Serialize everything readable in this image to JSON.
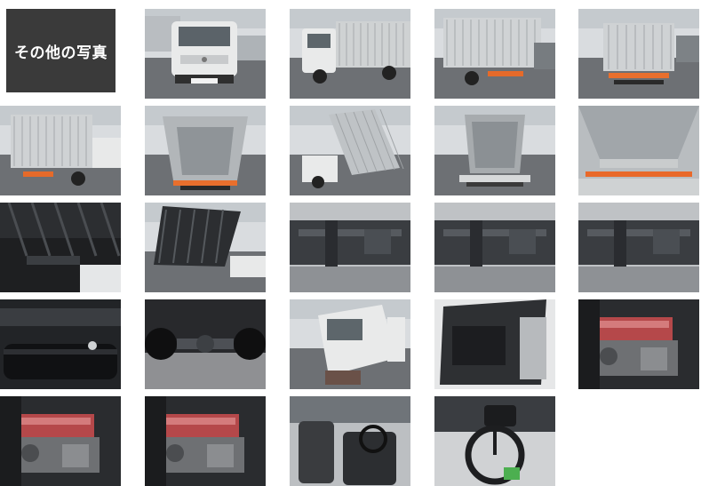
{
  "gallery": {
    "heading": "その他の写真",
    "thumbnails": [
      {
        "name": "photo-truck-front",
        "kind": "front"
      },
      {
        "name": "photo-truck-front-side",
        "kind": "frontside"
      },
      {
        "name": "photo-truck-rear-side",
        "kind": "rearside"
      },
      {
        "name": "photo-truck-rear",
        "kind": "rear"
      },
      {
        "name": "photo-truck-rear-left",
        "kind": "rearleft"
      },
      {
        "name": "photo-dump-bed-interior",
        "kind": "bedinterior"
      },
      {
        "name": "photo-dump-bed-raised-side",
        "kind": "raisedside"
      },
      {
        "name": "photo-dump-bed-raised-rear",
        "kind": "raisedrear"
      },
      {
        "name": "photo-bed-floor",
        "kind": "bedfloor"
      },
      {
        "name": "photo-hoist-underside",
        "kind": "underside"
      },
      {
        "name": "photo-hoist-raised",
        "kind": "raisedunder"
      },
      {
        "name": "photo-chassis-frame-1",
        "kind": "chassis"
      },
      {
        "name": "photo-chassis-frame-2",
        "kind": "chassis"
      },
      {
        "name": "photo-chassis-frame-3",
        "kind": "chassis"
      },
      {
        "name": "photo-fuel-tank",
        "kind": "tank"
      },
      {
        "name": "photo-rear-axle",
        "kind": "axle"
      },
      {
        "name": "photo-cab-tilted",
        "kind": "cabtilt"
      },
      {
        "name": "photo-cab-underside",
        "kind": "cabunder"
      },
      {
        "name": "photo-engine-1",
        "kind": "engine"
      },
      {
        "name": "photo-engine-2",
        "kind": "engine"
      },
      {
        "name": "photo-engine-3",
        "kind": "engine"
      },
      {
        "name": "photo-cab-seats",
        "kind": "seats"
      },
      {
        "name": "photo-dashboard-steering",
        "kind": "dash"
      }
    ]
  },
  "colors": {
    "label_bg": "#3a3a3a",
    "label_text": "#ffffff",
    "truck_white": "#e9eaea",
    "steel_gray": "#9c9fa2",
    "engine_red": "#b5484a"
  }
}
